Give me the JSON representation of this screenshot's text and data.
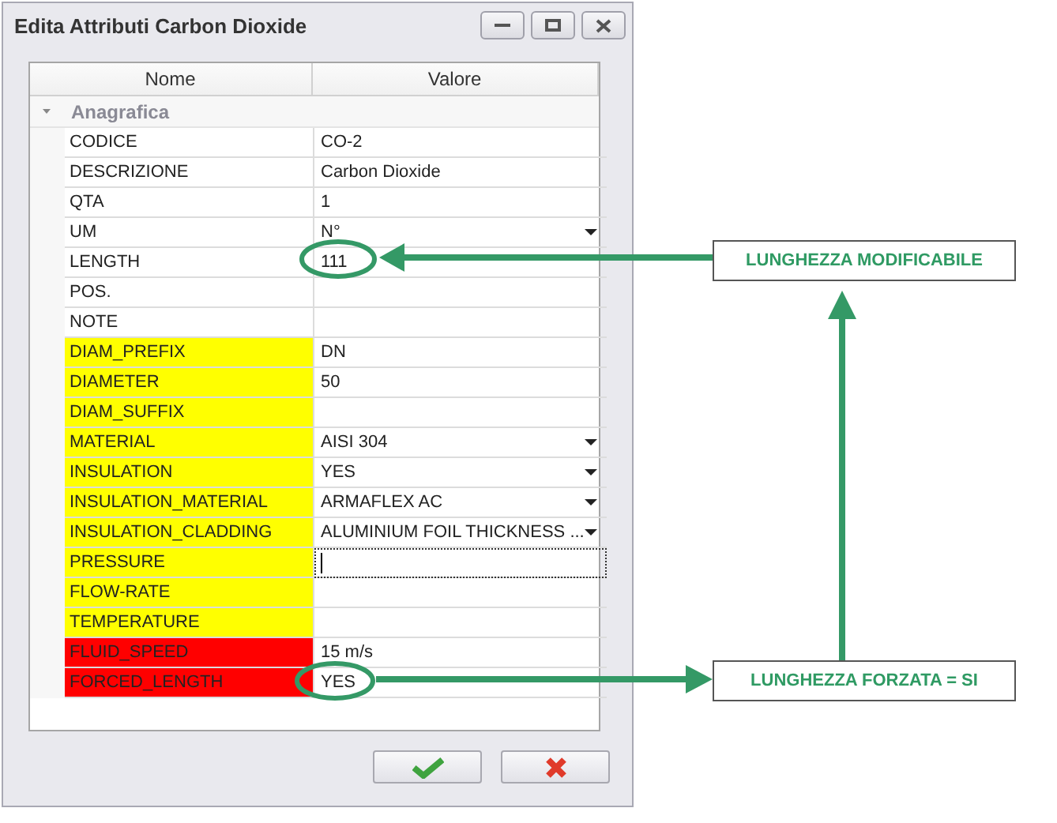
{
  "window": {
    "title": "Edita Attributi Carbon Dioxide"
  },
  "grid": {
    "columns": [
      "Nome",
      "Valore"
    ],
    "category": {
      "label": "Anagrafica",
      "expanded": true
    },
    "rows": [
      {
        "name": "CODICE",
        "value": "CO-2",
        "dropdown": false,
        "focused": false
      },
      {
        "name": "DESCRIZIONE",
        "value": "Carbon Dioxide",
        "dropdown": false,
        "focused": false
      },
      {
        "name": "QTA",
        "value": "1",
        "dropdown": false,
        "focused": false
      },
      {
        "name": "UM",
        "value": "N°",
        "dropdown": true,
        "focused": false
      },
      {
        "name": "LENGTH",
        "value": "111",
        "dropdown": false,
        "focused": false
      },
      {
        "name": "POS.",
        "dropdown": false,
        "focused": false
      },
      {
        "name": "NOTE",
        "dropdown": false,
        "focused": false
      },
      {
        "name": "DIAM_PREFIX",
        "value": "DN",
        "color": "#ffff00",
        "dropdown": false,
        "focused": false
      },
      {
        "name": "DIAMETER",
        "value": "50",
        "color": "#ffff00",
        "dropdown": false,
        "focused": false
      },
      {
        "name": "DIAM_SUFFIX",
        "color": "#ffff00",
        "dropdown": false,
        "focused": false
      },
      {
        "name": "MATERIAL",
        "value": "AISI 304",
        "color": "#ffff00",
        "dropdown": true,
        "focused": false
      },
      {
        "name": "INSULATION",
        "value": "YES",
        "color": "#ffff00",
        "dropdown": true,
        "focused": false
      },
      {
        "name": "INSULATION_MATERIAL",
        "value": "ARMAFLEX AC",
        "color": "#ffff00",
        "dropdown": true,
        "focused": false
      },
      {
        "name": "INSULATION_CLADDING",
        "value": "ALUMINIUM FOIL THICKNESS ...",
        "color": "#ffff00",
        "dropdown": true,
        "focused": false
      },
      {
        "name": "PRESSURE",
        "color": "#ffff00",
        "dropdown": false,
        "focused": true
      },
      {
        "name": "FLOW-RATE",
        "color": "#ffff00",
        "dropdown": false,
        "focused": false
      },
      {
        "name": "TEMPERATURE",
        "color": "#ffff00",
        "dropdown": false,
        "focused": false
      },
      {
        "name": "FLUID_SPEED",
        "value": "15 m/s",
        "color": "#ff0000",
        "dropdown": false,
        "focused": false
      },
      {
        "name": "FORCED_LENGTH",
        "value": "YES",
        "color": "#ff0000",
        "dropdown": false,
        "focused": false
      }
    ]
  },
  "annotations": [
    "LUNGHEZZA MODIFICABILE",
    "LUNGHEZZA FORZATA = SI"
  ]
}
